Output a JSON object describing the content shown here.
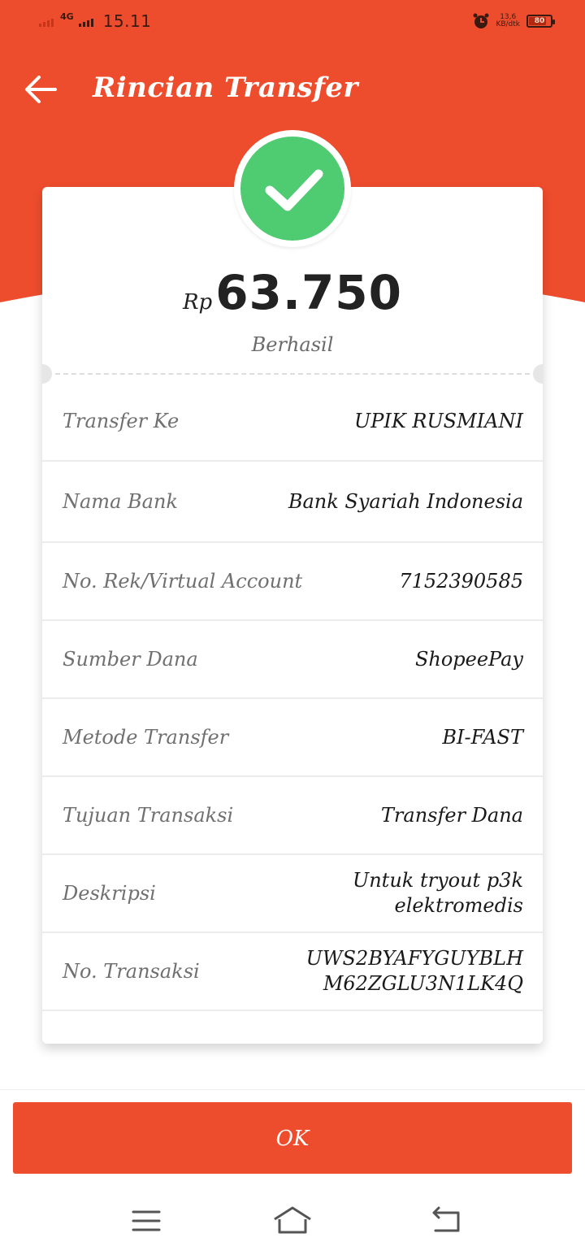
{
  "status_bar": {
    "network": "4G",
    "time": "15.11",
    "speed_value": "13,6",
    "speed_unit": "KB/dtk",
    "battery_level": 80,
    "battery_label": "80"
  },
  "header": {
    "title": "Rincian Transfer",
    "back_icon": "arrow-left-icon"
  },
  "summary": {
    "currency": "Rp",
    "amount": "63.750",
    "status": "Berhasil",
    "status_icon": "check-icon"
  },
  "details": [
    {
      "label": "Transfer Ke",
      "value": "UPIK RUSMIANI"
    },
    {
      "label": "Nama Bank",
      "value": "Bank Syariah Indonesia"
    },
    {
      "label": "No. Rek/Virtual Account",
      "value": "7152390585"
    },
    {
      "label": "Sumber Dana",
      "value": "ShopeePay"
    },
    {
      "label": "Metode Transfer",
      "value": "BI-FAST"
    },
    {
      "label": "Tujuan Transaksi",
      "value": "Transfer Dana"
    },
    {
      "label": "Deskripsi",
      "value_line1": "Untuk tryout p3k",
      "value_line2": "elektromedis"
    },
    {
      "label": "No. Transaksi",
      "value_line1": "UWS2BYAFYGUYBLH",
      "value_line2": "M62ZGLU3N1LK4Q"
    }
  ],
  "actions": {
    "ok_label": "OK"
  },
  "colors": {
    "brand": "#ee4d2d",
    "success": "#4fcb72"
  },
  "nav_icons": [
    "menu-icon",
    "home-icon",
    "back-icon"
  ]
}
